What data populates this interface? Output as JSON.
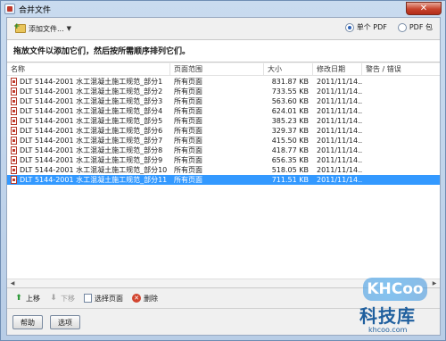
{
  "window": {
    "title": "合并文件",
    "close_glyph": "✕"
  },
  "toolbar": {
    "add_files_label": "添加文件...",
    "radio_single": "单个 PDF",
    "radio_package": "PDF 包",
    "selected": "single"
  },
  "instruction": "拖放文件以添加它们，然后按所需顺序排列它们。",
  "columns": [
    "名称",
    "页面范围",
    "大小",
    "修改日期",
    "警告 / 错误"
  ],
  "rows": [
    {
      "name": "DLT 5144-2001 水工混凝土施工规范_部分1",
      "range": "所有页面",
      "size": "831.87 KB",
      "date": "2011/11/14..."
    },
    {
      "name": "DLT 5144-2001 水工混凝土施工规范_部分2",
      "range": "所有页面",
      "size": "733.55 KB",
      "date": "2011/11/14..."
    },
    {
      "name": "DLT 5144-2001 水工混凝土施工规范_部分3",
      "range": "所有页面",
      "size": "563.60 KB",
      "date": "2011/11/14..."
    },
    {
      "name": "DLT 5144-2001 水工混凝土施工规范_部分4",
      "range": "所有页面",
      "size": "624.01 KB",
      "date": "2011/11/14..."
    },
    {
      "name": "DLT 5144-2001 水工混凝土施工规范_部分5",
      "range": "所有页面",
      "size": "385.23 KB",
      "date": "2011/11/14..."
    },
    {
      "name": "DLT 5144-2001 水工混凝土施工规范_部分6",
      "range": "所有页面",
      "size": "329.37 KB",
      "date": "2011/11/14..."
    },
    {
      "name": "DLT 5144-2001 水工混凝土施工规范_部分7",
      "range": "所有页面",
      "size": "415.50 KB",
      "date": "2011/11/14..."
    },
    {
      "name": "DLT 5144-2001 水工混凝土施工规范_部分8",
      "range": "所有页面",
      "size": "418.77 KB",
      "date": "2011/11/14..."
    },
    {
      "name": "DLT 5144-2001 水工混凝土施工规范_部分9",
      "range": "所有页面",
      "size": "656.35 KB",
      "date": "2011/11/14..."
    },
    {
      "name": "DLT 5144-2001 水工混凝土施工规范_部分10",
      "range": "所有页面",
      "size": "518.05 KB",
      "date": "2011/11/14..."
    },
    {
      "name": "DLT 5144-2001 水工混凝土施工规范_部分11",
      "range": "所有页面",
      "size": "711.51 KB",
      "date": "2011/11/14..."
    }
  ],
  "selected_row": 10,
  "bottom_tools": {
    "up": "上移",
    "down": "下移",
    "select_pages": "选择页面",
    "delete": "删除"
  },
  "footer": {
    "help": "帮助",
    "options": "选项"
  },
  "watermark": {
    "logo": "KHCoo",
    "cn": "科技库",
    "url": "khcoo.com"
  },
  "colors": {
    "selection": "#3399ff",
    "accent": "#2d62b8"
  }
}
